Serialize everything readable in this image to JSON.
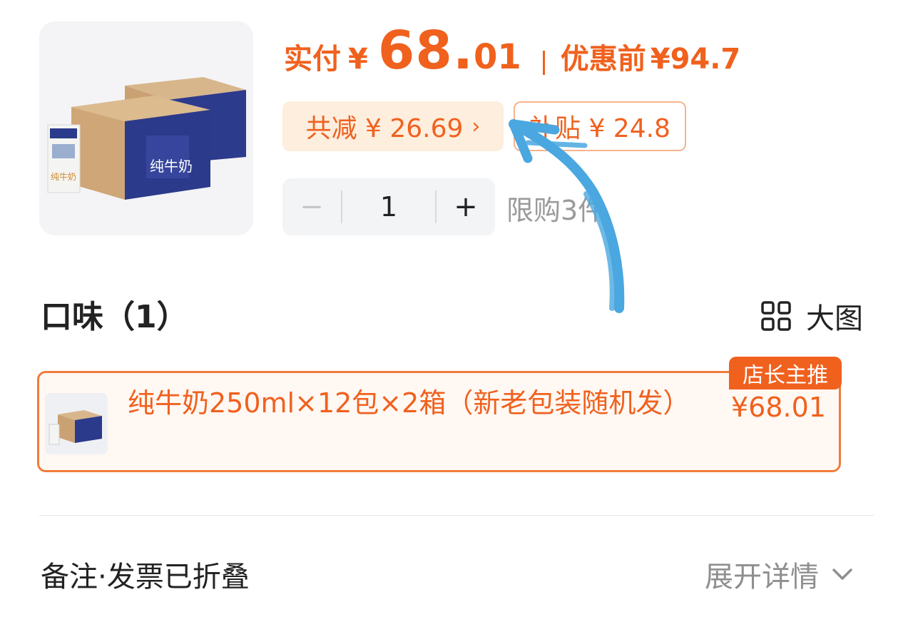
{
  "price": {
    "pay_label": "实付",
    "currency": "¥",
    "pay_integer": "68.",
    "pay_decimal": "01",
    "original_label": "优惠前",
    "original_price": "¥94.7"
  },
  "tags": {
    "discount": "共减 ¥ 26.69",
    "discount_chevron": "›",
    "subsidy": "补贴 ¥ 24.8"
  },
  "stepper": {
    "minus": "−",
    "value": "1",
    "plus": "+"
  },
  "limit_text": "限购3件",
  "flavor": {
    "title": "口味（1）",
    "bigpic_label": "大图"
  },
  "option": {
    "label": "纯牛奶250ml×12包×2箱（新老包装随机发）",
    "price": "¥68.01",
    "badge": "店长主推"
  },
  "remark": {
    "title": "备注·发票已折叠",
    "expand_label": "展开详情"
  },
  "colors": {
    "accent": "#f0611e",
    "tag_bg": "#fdeede",
    "annotation": "#4aa7e0"
  }
}
